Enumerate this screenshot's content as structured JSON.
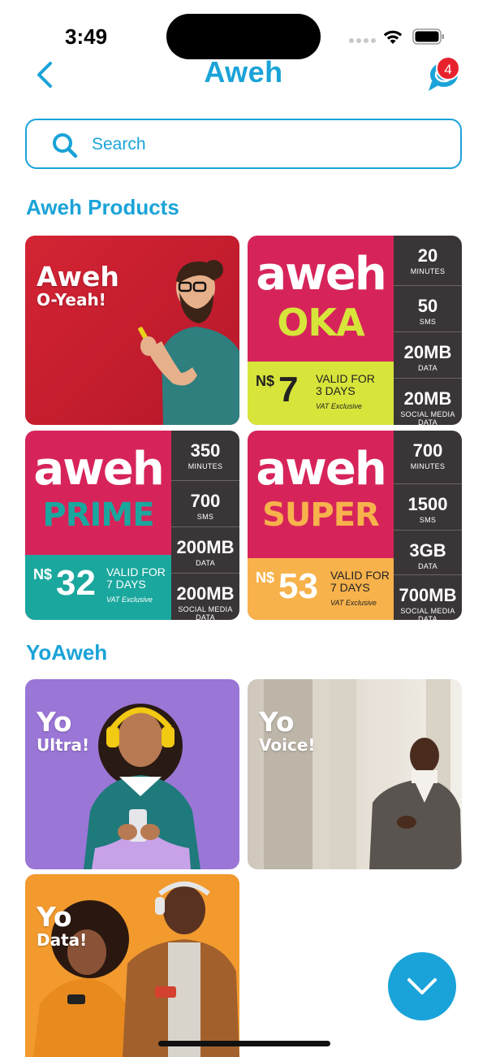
{
  "status_bar": {
    "time": "3:49"
  },
  "nav": {
    "title": "Aweh",
    "notification_count": "4"
  },
  "search": {
    "placeholder": "Search"
  },
  "sections": {
    "aweh_products": "Aweh Products",
    "yoaweh": "YoAweh"
  },
  "aweh_products": [
    {
      "title_line1": "Aweh",
      "title_line2": "O-Yeah!"
    },
    {
      "brand_line1": "aweh",
      "brand_line2": "OKA",
      "currency": "N$",
      "price": "7",
      "validity_line1": "VALID FOR",
      "validity_line2": "3 DAYS",
      "vat": "VAT Exclusive",
      "stats": [
        {
          "value": "20",
          "unit": "MINUTES"
        },
        {
          "value": "50",
          "unit": "SMS"
        },
        {
          "value": "20MB",
          "unit": "DATA"
        },
        {
          "value": "20MB",
          "unit": "SOCIAL MEDIA DATA"
        }
      ]
    },
    {
      "brand_line1": "aweh",
      "brand_line2": "PRIME",
      "currency": "N$",
      "price": "32",
      "validity_line1": "VALID FOR",
      "validity_line2": "7 DAYS",
      "vat": "VAT Exclusive",
      "stats": [
        {
          "value": "350",
          "unit": "MINUTES"
        },
        {
          "value": "700",
          "unit": "SMS"
        },
        {
          "value": "200MB",
          "unit": "DATA"
        },
        {
          "value": "200MB",
          "unit": "SOCIAL MEDIA DATA"
        }
      ]
    },
    {
      "brand_line1": "aweh",
      "brand_line2": "SUPER",
      "currency": "N$",
      "price": "53",
      "validity_line1": "VALID FOR",
      "validity_line2": "7 DAYS",
      "vat": "VAT Exclusive",
      "stats": [
        {
          "value": "700",
          "unit": "MINUTES"
        },
        {
          "value": "1500",
          "unit": "SMS"
        },
        {
          "value": "3GB",
          "unit": "DATA"
        },
        {
          "value": "700MB",
          "unit": "SOCIAL MEDIA DATA"
        }
      ]
    }
  ],
  "yoaweh_products": [
    {
      "title_line1": "Yo",
      "title_line2": "Ultra!"
    },
    {
      "title_line1": "Yo",
      "title_line2": "Voice!"
    },
    {
      "title_line1": "Yo",
      "title_line2": "Data!"
    }
  ],
  "colors": {
    "accent": "#1aa3d8",
    "badge": "#e8222d",
    "oyeah_bg": "#c91f2f",
    "oka_brand": "#d6245a",
    "oka_price": "#d7e43a",
    "prime_brand": "#d6245a",
    "prime_price": "#1aa79e",
    "super_brand": "#d6245a",
    "super_price": "#f7b24c",
    "stats_panel": "#3a3536",
    "ultra_bg": "#9a76d6",
    "voice_bg": "#d8d2c8",
    "data_bg": "#f29a2e"
  },
  "icons": {
    "back": "chevron-left-icon",
    "chat": "chat-bubble-icon",
    "search": "search-icon",
    "scroll": "chevron-down-icon"
  }
}
